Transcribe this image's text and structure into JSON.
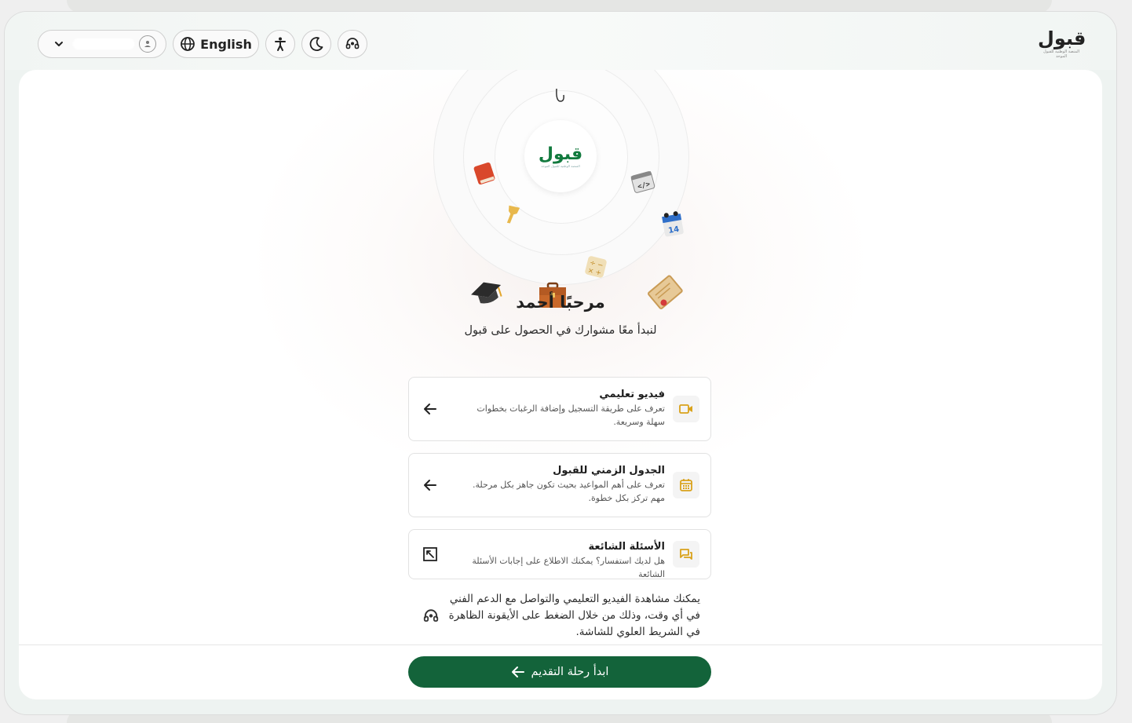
{
  "header": {
    "user_name": "",
    "language_label": "English",
    "icons": {
      "user_dropdown": "chevron-down-icon",
      "user": "user-icon",
      "language": "globe-icon",
      "accessibility": "accessibility-icon",
      "theme": "moon-icon",
      "support": "headset-icon"
    },
    "logo": {
      "word": "قبول",
      "sub": "المنصة الوطنية للقبول الموحد"
    }
  },
  "hero": {
    "center_logo": {
      "word": "قبول",
      "sub": "المنصة الوطنية للقبول الموحد"
    },
    "floating_icons": [
      "book-icon",
      "code-icon",
      "trophy-icon",
      "calendar-icon",
      "calculator-icon",
      "graduation-cap-icon",
      "briefcase-icon",
      "certificate-icon"
    ]
  },
  "welcome": {
    "title": "مرحبًا أحمد",
    "subtitle": "لنبدأ معًا مشوارك في الحصول على قبول"
  },
  "options": [
    {
      "title": "فيديو تعليمي",
      "description": "تعرف على طريقة التسجيل وإضافة الرغبات بخطوات سهلة وسريعة.",
      "icon": "video-icon",
      "action_icon": "arrow-left-icon"
    },
    {
      "title": "الجدول الزمني للقبول",
      "description": "تعرف على أهم المواعيد بحيث تكون جاهز بكل مرحلة. مهم تركز بكل خطوة.",
      "icon": "calendar-icon",
      "action_icon": "arrow-left-icon"
    },
    {
      "title": "الأسئلة الشائعة",
      "description": "هل لديك استفسار؟ يمكنك الاطلاع على إجابات الأسئلة الشائعة",
      "icon": "chat-icon",
      "action_icon": "external-link-icon"
    }
  ],
  "support_note": "يمكنك مشاهدة الفيديو التعليمي والتواصل مع الدعم الفني في أي وقت، وذلك من خلال الضغط على الأيقونة الظاهرة في الشريط العلوي للشاشة.",
  "start_button": {
    "label": "ابدأ رحلة التقديم"
  },
  "colors": {
    "primary": "#13633a",
    "accent": "#d9a21b",
    "logo_green": "#127a3e"
  }
}
